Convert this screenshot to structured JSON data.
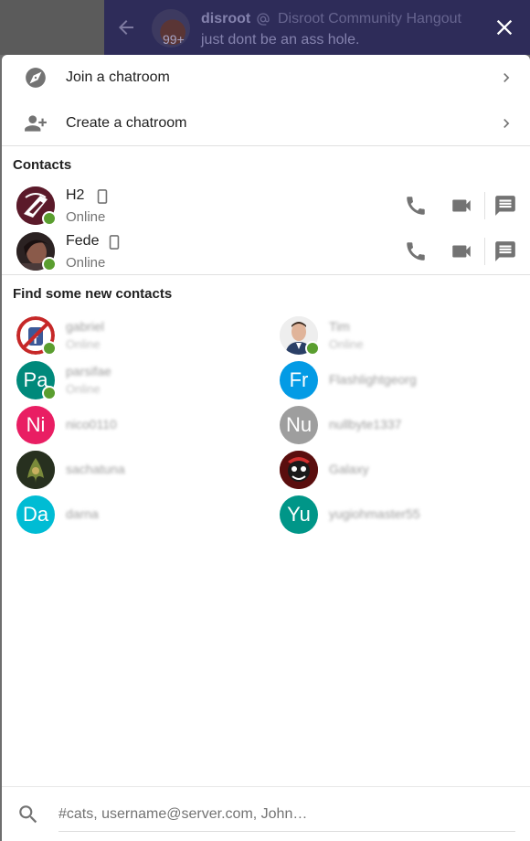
{
  "background": {
    "room_name": "disroot",
    "room_title": "Disroot Community Hangout",
    "topic": "just dont be an ass hole.",
    "unread_badge": "99+"
  },
  "menu": {
    "join_label": "Join a chatroom",
    "create_label": "Create a chatroom"
  },
  "contacts": {
    "title": "Contacts",
    "items": [
      {
        "name": "H2",
        "status": "Online"
      },
      {
        "name": "Fede",
        "status": "Online"
      }
    ]
  },
  "suggestions": {
    "title": "Find some new contacts",
    "items": [
      {
        "name": "gabriel",
        "sub": "Online",
        "initials": "",
        "color": "#c62828"
      },
      {
        "name": "Tim",
        "sub": "Online",
        "initials": "",
        "color": "#e0e0e0"
      },
      {
        "name": "parsifae",
        "sub": "Online",
        "initials": "Pa",
        "color": "#00897b"
      },
      {
        "name": "Flashlightgeorg",
        "sub": "",
        "initials": "Fr",
        "color": "#039be5"
      },
      {
        "name": "nico0110",
        "sub": "",
        "initials": "Ni",
        "color": "#e91e63"
      },
      {
        "name": "nullbyte1337",
        "sub": "",
        "initials": "Nu",
        "color": "#9e9e9e"
      },
      {
        "name": "sachatuna",
        "sub": "",
        "initials": "",
        "color": "#3e4a2e"
      },
      {
        "name": "Galaxy",
        "sub": "",
        "initials": "",
        "color": "#8e1c1c"
      },
      {
        "name": "darna",
        "sub": "",
        "initials": "Da",
        "color": "#00bcd4"
      },
      {
        "name": "yugiohmaster55",
        "sub": "",
        "initials": "Yu",
        "color": "#009688"
      }
    ]
  },
  "search": {
    "placeholder": "#cats, username@server.com, John…"
  },
  "colors": {
    "online": "#5a9e2f",
    "header_bg": "#2e2c59",
    "icon_gray": "#737373"
  }
}
